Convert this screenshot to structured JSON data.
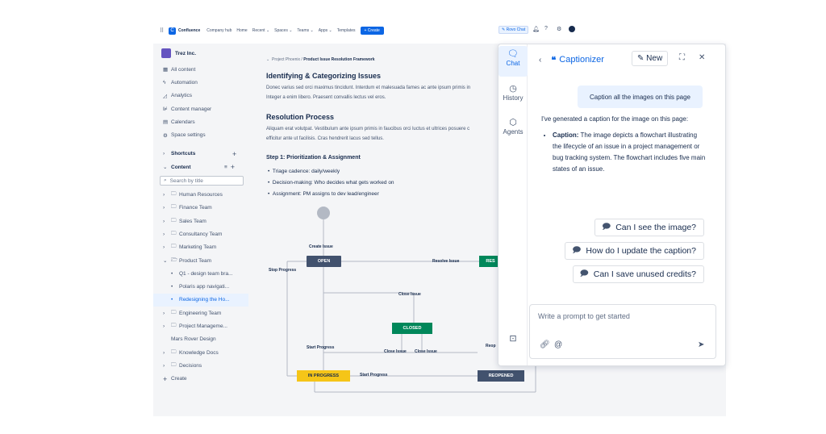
{
  "topnav": {
    "brand": "Confluence",
    "items": [
      "Company hub",
      "Home",
      "Recent ⌄",
      "Spaces ⌄",
      "Teams ⌄",
      "Apps ⌄",
      "Templates"
    ],
    "create": "+ Create",
    "rovo_chat": "Rovo Chat"
  },
  "sidebar": {
    "space_name": "Trez Inc.",
    "nav": [
      "All content",
      "Automation",
      "Analytics",
      "Content manager",
      "Calendars",
      "Space settings"
    ],
    "shortcuts": "Shortcuts",
    "content": "Content",
    "search_placeholder": "Search by title",
    "tree": [
      "Human Resources",
      "Finance Team",
      "Sales Team",
      "Consultancy Team",
      "Marketing Team",
      "Product Team",
      "Q1 - design team bra...",
      "Polaris app navigati...",
      "Redesigning the Ho...",
      "Engineering Team",
      "Project Manageme...",
      "Mars Rover Design",
      "Knowledge Docs",
      "Decisions"
    ],
    "create": "Create"
  },
  "page": {
    "breadcrumb_parent": "Project Phoenix",
    "breadcrumb_current": "Product Issue Resolution Framework",
    "h_identify": "Identifying & Categorizing Issues",
    "p_identify_1": "Donec varius sed orci maximus tincidunt. Interdum et malesuada fames ac ante ipsum primis in",
    "p_identify_2": "Integer a enim libero. Praesent convallis lectus vel eros.",
    "h_resolution": "Resolution Process",
    "p_resolution_1": "Aliquam erat volutpat. Vestibulum ante ipsum primis in faucibus orci luctus et ultrices posuere c",
    "p_resolution_2": "efficitur ante ut facilisis. Cras hendrerit lacus sed tellus.",
    "h_step1": "Step 1: Prioritization & Assignment",
    "bullets": [
      "Triage cadence: daily/weekly",
      "Decision-making: Who decides what gets worked on",
      "Assignment: PM assigns to dev lead/engineer"
    ]
  },
  "flow": {
    "nodes": {
      "open": "OPEN",
      "resolved": "RES",
      "closed": "CLOSED",
      "in_progress": "IN PROGRESS",
      "reopened": "REOPENED"
    },
    "labels": {
      "create_issue": "Create Issue",
      "stop_progress": "Stop Progress",
      "resolve_issue": "Resolve Issue",
      "close_issue_mid": "Close Issue",
      "start_progress_left": "Start Progress",
      "close_issue_a": "Close Issue",
      "close_issue_b": "Close Issue",
      "reopen": "Reop",
      "start_progress_bottom": "Start Progress"
    },
    "colors": {
      "open": "#42526e",
      "resolved": "#00875a",
      "closed": "#00875a",
      "in_progress": "#f5c518",
      "reopened": "#42526e"
    }
  },
  "panel": {
    "rail": {
      "chat": "Chat",
      "history": "History",
      "agents": "Agents"
    },
    "title": "Captionizer",
    "new_button": "New",
    "user_message": "Caption all the images on this page",
    "ai_intro": "I've generated a caption for the image on this page:",
    "ai_caption_label": "Caption:",
    "ai_caption_text": "The image depicts a flowchart illustrating the lifecycle of an issue in a project management or bug tracking system. The flowchart includes five main states of an issue.",
    "suggestions": [
      "Can I see the image?",
      "How do I update the caption?",
      "Can I save unused credits?"
    ],
    "prompt_placeholder": "Write a prompt to get started"
  }
}
